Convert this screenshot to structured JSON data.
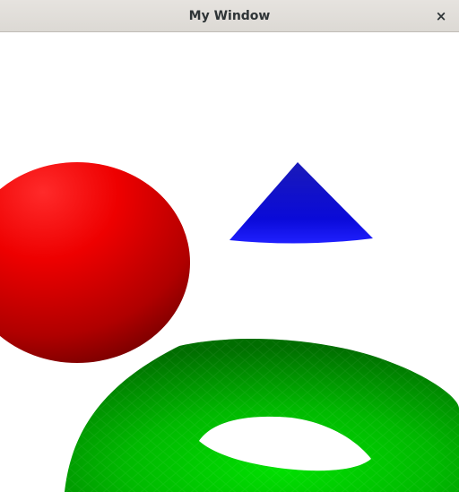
{
  "window": {
    "title": "My Window",
    "close_glyph": "×"
  },
  "scene": {
    "background": "#ffffff",
    "objects": [
      {
        "name": "sphere",
        "color": "#ff0000"
      },
      {
        "name": "cone",
        "color": "#0000ff"
      },
      {
        "name": "torus",
        "color": "#00c000"
      }
    ]
  }
}
